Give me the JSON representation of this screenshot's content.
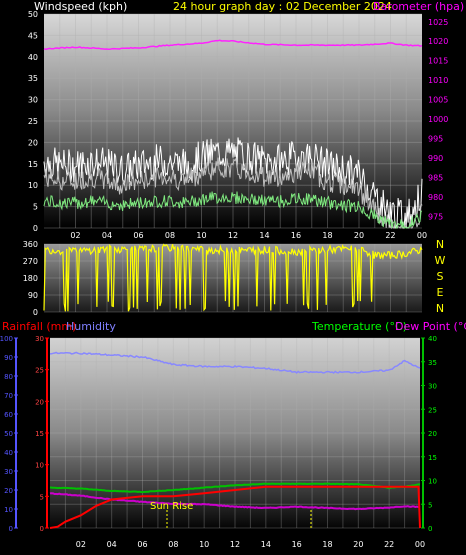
{
  "header": {
    "wind_title": "Windspeed (kph)",
    "graph_title": "24 hour graph day : 02 December 2024",
    "baro_title": "Barometer (hpa)"
  },
  "lower_header": {
    "rain_title": "Rainfall (mm)",
    "hum_title": "Humidity",
    "temp_title": "Temperature (°C)",
    "dew_title": "Dew Point (°C)"
  },
  "sun_rise_label": "Sun Rise",
  "colors": {
    "wind_gust": "#ffffff",
    "wind_avg": "#bfbfbf",
    "wind_low": "#7fe87f",
    "barometer": "#ff22ff",
    "direction": "#ffff00",
    "rainfall": "#ff0000",
    "humidity": "#8888ff",
    "temperature": "#00c000",
    "dewpoint": "#cc00cc",
    "wind_title": "#ffffff",
    "graph_title": "#ffff00",
    "baro_title": "#ff00ff",
    "temp_title": "#00ff00",
    "rain_title": "#ff0000",
    "hum_title": "#8080ff"
  },
  "chart_data": [
    {
      "type": "line",
      "x_tick_labels": [
        "02",
        "04",
        "06",
        "08",
        "10",
        "12",
        "14",
        "16",
        "18",
        "20",
        "22",
        "00"
      ],
      "left_axis": {
        "ticks": [
          0,
          5,
          10,
          15,
          20,
          25,
          30,
          35,
          40,
          45,
          50
        ],
        "ylim": [
          0,
          50
        ]
      },
      "right_axis": {
        "ticks": [
          975,
          980,
          985,
          990,
          995,
          1000,
          1005,
          1010,
          1015,
          1020,
          1025
        ],
        "ylim": [
          972,
          1027
        ]
      },
      "series": [
        {
          "name": "Windspeed (kph)",
          "axis": "left",
          "x": [
            0,
            1,
            2,
            3,
            4,
            5,
            6,
            7,
            8,
            9,
            10,
            11,
            12,
            13,
            14,
            15,
            16,
            17,
            18,
            19,
            20,
            21,
            22,
            23,
            24
          ],
          "y": [
            14,
            13,
            13,
            14,
            13,
            12,
            13,
            14,
            14,
            13,
            15,
            16,
            16,
            15,
            14,
            14,
            15,
            15,
            13,
            12,
            11,
            6,
            2,
            1,
            6
          ]
        },
        {
          "name": "Barometer (hpa)",
          "axis": "right",
          "x": [
            0,
            2,
            4,
            6,
            8,
            10,
            11,
            12,
            14,
            16,
            18,
            20,
            22,
            23,
            24
          ],
          "y": [
            1018,
            1018.5,
            1018,
            1018.3,
            1019,
            1019.5,
            1020.2,
            1020,
            1019.2,
            1019,
            1019,
            1019,
            1019.5,
            1019,
            1018.8
          ]
        }
      ]
    },
    {
      "type": "line",
      "x_tick_labels": [
        "02",
        "04",
        "06",
        "08",
        "10",
        "12",
        "14",
        "16",
        "18",
        "20",
        "22",
        "00"
      ],
      "left_axis": {
        "ticks": [
          0,
          90,
          180,
          270,
          360
        ],
        "ylim": [
          0,
          360
        ]
      },
      "right_axis_labels": [
        "N",
        "W",
        "S",
        "E",
        "N"
      ],
      "series": [
        {
          "name": "Wind direction",
          "x": [
            0,
            2,
            4,
            6,
            8,
            10,
            12,
            14,
            16,
            18,
            20,
            21,
            22,
            23,
            24
          ],
          "y": [
            330,
            320,
            335,
            330,
            340,
            330,
            325,
            330,
            320,
            330,
            335,
            300,
            300,
            310,
            330
          ]
        }
      ]
    },
    {
      "type": "line",
      "x_tick_labels": [
        "02",
        "04",
        "06",
        "08",
        "10",
        "12",
        "14",
        "16",
        "18",
        "20",
        "22",
        "00"
      ],
      "left_axis_rain": {
        "ticks": [
          0,
          5,
          10,
          15,
          20,
          25,
          30
        ],
        "ylim": [
          0,
          30
        ]
      },
      "left_axis_humidity": {
        "ticks": [
          0,
          10,
          20,
          30,
          40,
          50,
          60,
          70,
          80,
          90,
          100
        ],
        "ylim": [
          0,
          100
        ]
      },
      "right_axis": {
        "ticks": [
          0,
          5,
          10,
          15,
          20,
          25,
          30,
          35,
          40
        ],
        "ylim": [
          0,
          40
        ]
      },
      "series": [
        {
          "name": "Rainfall (mm)",
          "axis": "rain",
          "x": [
            0,
            0.5,
            1,
            2,
            3,
            4,
            6,
            8,
            10,
            12,
            14,
            16,
            18,
            20,
            22,
            23.9,
            24
          ],
          "y": [
            0,
            0.2,
            1,
            2,
            3.5,
            4.5,
            5,
            5,
            5.5,
            6,
            6.5,
            6.5,
            6.5,
            6.5,
            6.5,
            6.5,
            0
          ]
        },
        {
          "name": "Humidity",
          "axis": "humidity",
          "x": [
            0,
            2,
            4,
            6,
            8,
            10,
            12,
            14,
            16,
            18,
            20,
            22,
            23,
            24
          ],
          "y": [
            92,
            92,
            91,
            90,
            86,
            85,
            85,
            84,
            82,
            82,
            82,
            83,
            88,
            84
          ]
        },
        {
          "name": "Temperature (°C)",
          "axis": "right",
          "x": [
            0,
            2,
            4,
            6,
            8,
            10,
            12,
            14,
            16,
            18,
            20,
            22,
            23,
            24
          ],
          "y": [
            8.5,
            8.3,
            7.8,
            7.6,
            8,
            8.5,
            9,
            9.3,
            9.3,
            9.3,
            9.2,
            8.5,
            8.7,
            9.2
          ]
        },
        {
          "name": "Dew Point (°C)",
          "axis": "right",
          "x": [
            0,
            2,
            4,
            6,
            8,
            10,
            12,
            14,
            16,
            18,
            20,
            22,
            23,
            24
          ],
          "y": [
            7.3,
            6.8,
            6,
            5.5,
            5.1,
            5,
            4.5,
            4.2,
            4.5,
            4.2,
            4,
            4.3,
            4.6,
            4.4
          ]
        }
      ]
    }
  ]
}
